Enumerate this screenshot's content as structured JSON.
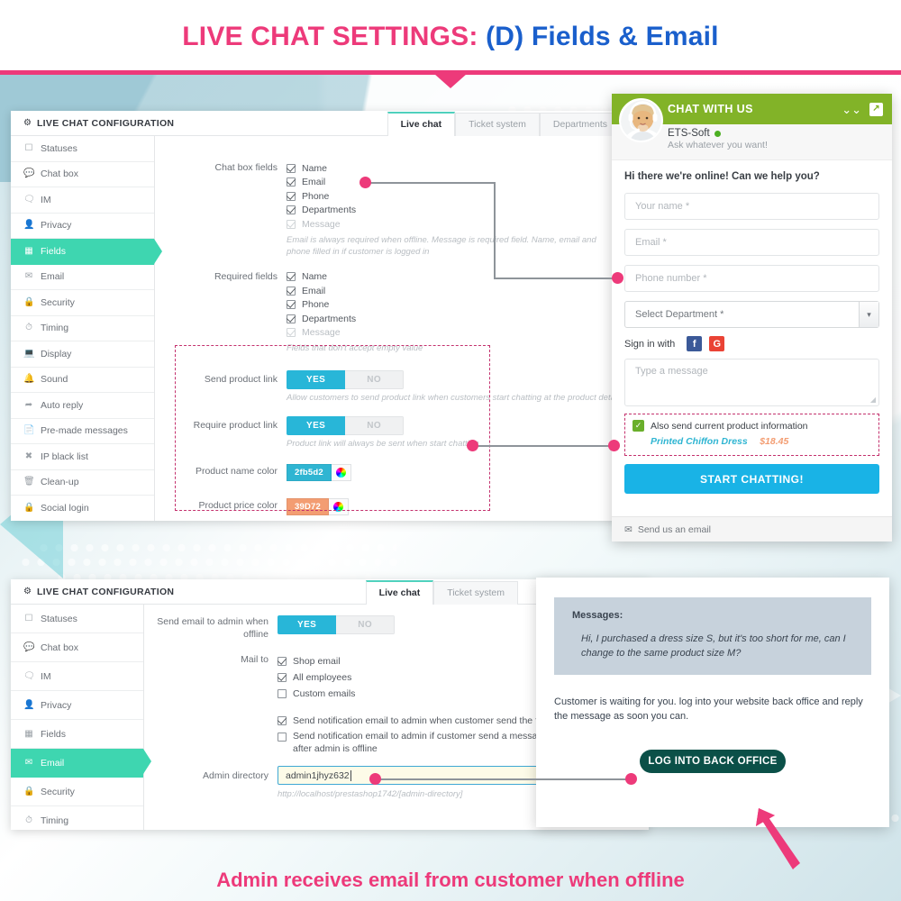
{
  "title": {
    "pink": "LIVE CHAT SETTINGS:",
    "blue": "(D) Fields & Email"
  },
  "caption": "Admin receives email from customer when offline",
  "colors": {
    "pink": "#ED3A7A",
    "blue": "#1A5FCC",
    "green_active": "#3ed6b0",
    "switch_on": "#28b6d8",
    "widget_header": "#82b328",
    "start_button": "#19b3e6",
    "mail_button": "#0b5048"
  },
  "panel_fields": {
    "header_title": "LIVE CHAT CONFIGURATION",
    "gear_icon": "gear-icon",
    "tabs": [
      {
        "label": "Live chat",
        "active": true
      },
      {
        "label": "Ticket system",
        "active": false
      },
      {
        "label": "Departments",
        "active": false
      }
    ],
    "sidebar": [
      {
        "label": "Statuses",
        "icon": "window-icon",
        "active": false
      },
      {
        "label": "Chat box",
        "icon": "comment-icon",
        "active": false
      },
      {
        "label": "IM",
        "icon": "comments-icon",
        "active": false
      },
      {
        "label": "Privacy",
        "icon": "user-icon",
        "active": false
      },
      {
        "label": "Fields",
        "icon": "list-icon",
        "active": true
      },
      {
        "label": "Email",
        "icon": "envelope-icon",
        "active": false
      },
      {
        "label": "Security",
        "icon": "lock-icon",
        "active": false
      },
      {
        "label": "Timing",
        "icon": "clock-icon",
        "active": false
      },
      {
        "label": "Display",
        "icon": "monitor-icon",
        "active": false
      },
      {
        "label": "Sound",
        "icon": "bell-icon",
        "active": false
      },
      {
        "label": "Auto reply",
        "icon": "reply-icon",
        "active": false
      },
      {
        "label": "Pre-made messages",
        "icon": "file-icon",
        "active": false
      },
      {
        "label": "IP black list",
        "icon": "times-icon",
        "active": false
      },
      {
        "label": "Clean-up",
        "icon": "trash-icon",
        "active": false
      },
      {
        "label": "Social login",
        "icon": "lock-icon",
        "active": false
      }
    ],
    "chat_box_fields": {
      "label": "Chat box fields",
      "items": [
        {
          "label": "Name",
          "checked": true,
          "disabled": false
        },
        {
          "label": "Email",
          "checked": true,
          "disabled": false
        },
        {
          "label": "Phone",
          "checked": true,
          "disabled": false
        },
        {
          "label": "Departments",
          "checked": true,
          "disabled": false
        },
        {
          "label": "Message",
          "checked": true,
          "disabled": true
        }
      ],
      "hint": "Email is always required when offline. Message is required field. Name, email and phone filled in if customer is logged in"
    },
    "required_fields": {
      "label": "Required fields",
      "items": [
        {
          "label": "Name",
          "checked": true,
          "disabled": false
        },
        {
          "label": "Email",
          "checked": true,
          "disabled": false
        },
        {
          "label": "Phone",
          "checked": true,
          "disabled": false
        },
        {
          "label": "Departments",
          "checked": true,
          "disabled": false
        },
        {
          "label": "Message",
          "checked": true,
          "disabled": true
        }
      ],
      "hint": "Fields that don't accept empty value"
    },
    "send_product_link": {
      "label": "Send product link",
      "yes": "YES",
      "no": "NO",
      "value": "YES",
      "hint": "Allow customers to send product link when customers start chatting at the product detail"
    },
    "require_product_link": {
      "label": "Require product link",
      "yes": "YES",
      "no": "NO",
      "value": "YES",
      "hint": "Product link will always be sent when start chatting"
    },
    "product_name_color": {
      "label": "Product name color",
      "value": "2fb5d2",
      "swatch": "#2fb5d2",
      "picker_icon": "color-wheel-icon"
    },
    "product_price_color": {
      "label": "Product price color",
      "value": "39D72",
      "swatch": "#f39d72",
      "picker_icon": "color-wheel-icon"
    }
  },
  "chat_widget": {
    "header_title": "CHAT WITH US",
    "collapse_icon": "chevron-double-down-icon",
    "expand_icon": "expand-icon",
    "avatar": "agent-avatar",
    "agent_name": "ETS-Soft",
    "status": "online",
    "tagline": "Ask whatever you want!",
    "greeting": "Hi there we're online! Can we help you?",
    "inputs": [
      {
        "name": "name-input",
        "placeholder": "Your name *"
      },
      {
        "name": "email-input",
        "placeholder": "Email *"
      },
      {
        "name": "phone-input",
        "placeholder": "Phone number *"
      }
    ],
    "department_select": {
      "placeholder": "Select Department *",
      "caret": "chevron-down-icon"
    },
    "signin": {
      "label": "Sign in with",
      "facebook": "f",
      "google": "G"
    },
    "message_placeholder": "Type a message",
    "product_info": {
      "checkbox_label": "Also send current product information",
      "checked": true,
      "product_name": "Printed Chiffon Dress",
      "product_price": "$18.45"
    },
    "start_button": "START CHATTING!",
    "footer": {
      "icon": "envelope-icon",
      "label": "Send us an email"
    }
  },
  "panel_email": {
    "header_title": "LIVE CHAT CONFIGURATION",
    "gear_icon": "gear-icon",
    "tabs": [
      {
        "label": "Live chat",
        "active": true
      },
      {
        "label": "Ticket system",
        "active": false
      }
    ],
    "sidebar": [
      {
        "label": "Statuses",
        "icon": "window-icon",
        "active": false
      },
      {
        "label": "Chat box",
        "icon": "comment-icon",
        "active": false
      },
      {
        "label": "IM",
        "icon": "comments-icon",
        "active": false
      },
      {
        "label": "Privacy",
        "icon": "user-icon",
        "active": false
      },
      {
        "label": "Fields",
        "icon": "list-icon",
        "active": false
      },
      {
        "label": "Email",
        "icon": "envelope-icon",
        "active": true
      },
      {
        "label": "Security",
        "icon": "lock-icon",
        "active": false
      },
      {
        "label": "Timing",
        "icon": "clock-icon",
        "active": false
      }
    ],
    "send_email_offline": {
      "label": "Send email to admin when offline",
      "yes": "YES",
      "no": "NO",
      "value": "YES"
    },
    "mail_to": {
      "label": "Mail to",
      "items": [
        {
          "label": "Shop email",
          "checked": true
        },
        {
          "label": "All employees",
          "checked": true
        },
        {
          "label": "Custom emails",
          "checked": false
        }
      ]
    },
    "notifications": [
      {
        "label": "Send notification email to admin when customer send the first message",
        "checked": true
      },
      {
        "label": "Send notification email to admin if customer send a message after admin is offline",
        "checked": false
      }
    ],
    "admin_directory": {
      "label": "Admin directory",
      "value": "admin1jhyz632",
      "hint": "http://localhost/prestashop1742/[admin-directory]"
    }
  },
  "mail_preview": {
    "messages_label": "Messages:",
    "message_text": "Hi, I purchased a dress size S, but it's too short for me, can I change to the same product size M?",
    "note": "Customer is waiting for you. log into your website back office and reply the message as soon you can.",
    "button": "LOG INTO BACK OFFICE"
  }
}
